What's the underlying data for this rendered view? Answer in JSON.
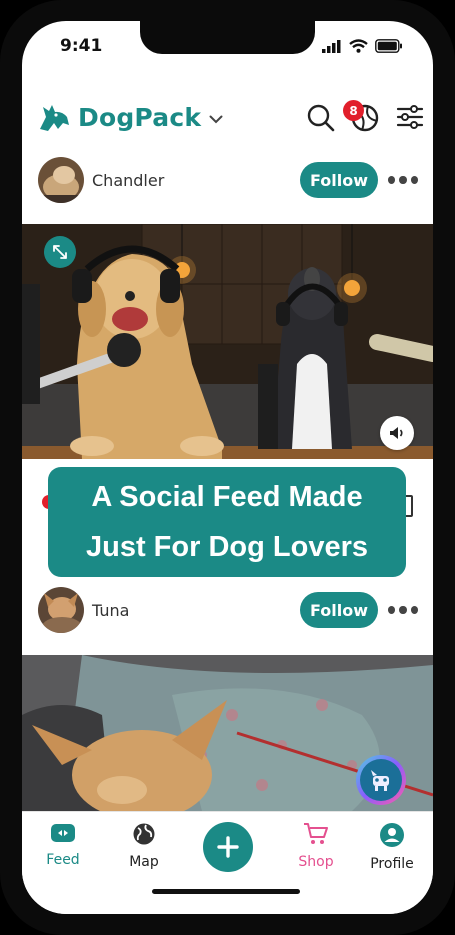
{
  "status": {
    "time": "9:41"
  },
  "header": {
    "app_name": "DogPack",
    "notification_count": "8"
  },
  "posts": [
    {
      "username": "Chandler",
      "follow_label": "Follow"
    },
    {
      "username": "Tuna",
      "follow_label": "Follow"
    }
  ],
  "banner": {
    "line1": "A Social Feed Made",
    "line2": "Just For Dog Lovers"
  },
  "tabbar": {
    "items": [
      {
        "label": "Feed",
        "icon": "feed-icon",
        "color": "#1b8a86"
      },
      {
        "label": "Map",
        "icon": "globe-icon",
        "color": "#222222"
      },
      {
        "label": "",
        "icon": "plus-icon",
        "color": "#1b8a86"
      },
      {
        "label": "Shop",
        "icon": "cart-icon",
        "color": "#e4508f"
      },
      {
        "label": "Profile",
        "icon": "profile-icon",
        "color": "#1b8a86"
      }
    ]
  },
  "colors": {
    "accent": "#1b8a86",
    "badge": "#e11f2b",
    "shop": "#e4508f"
  }
}
